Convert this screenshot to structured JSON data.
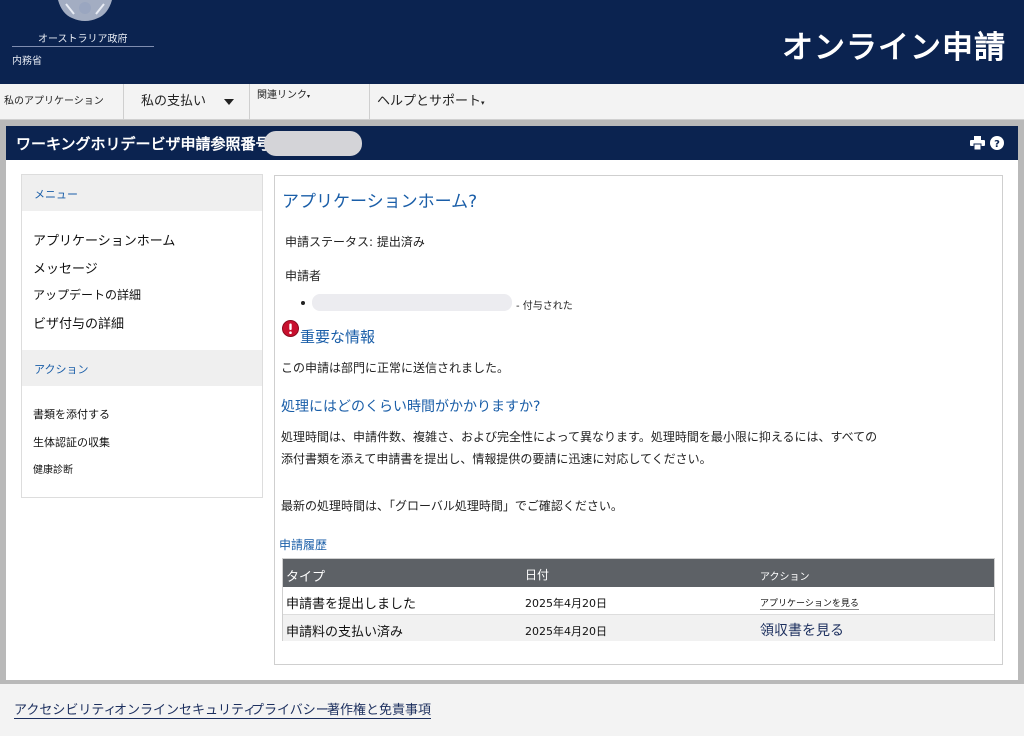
{
  "header": {
    "gov_name": "オーストラリア政府",
    "dept_name": "内務省",
    "title": "オンライン申請"
  },
  "nav": {
    "my_applications": "私のアプリケーション",
    "my_payments": "私の支払い",
    "related_links": "関連リンク",
    "help_support": "ヘルプとサポート"
  },
  "panel": {
    "title": "ワーキングホリデービザ申請参照番号"
  },
  "sidebar": {
    "menu_heading": "メニュー",
    "menu_items": [
      "アプリケーションホーム",
      "メッセージ",
      "アップデートの詳細",
      "ビザ付与の詳細"
    ],
    "action_heading": "アクション",
    "action_items": [
      "書類を添付する",
      "生体認証の収集",
      "健康診断"
    ]
  },
  "main": {
    "title": "アプリケーションホーム?",
    "status": "申請ステータス: 提出済み",
    "applicant_label": "申請者",
    "applicant_status": "- 付与された",
    "important_heading": "重要な情報",
    "sent_message": "この申請は部門に正常に送信されました。",
    "processing_heading": "処理にはどのくらい時間がかかりますか?",
    "processing_line1": "処理時間は、申請件数、複雑さ、および完全性によって異なります。処理時間を最小限に抑えるには、すべての",
    "processing_line2": "添付書類を添えて申請書を提出し、情報提供の要請に迅速に対応してください。",
    "latest_time": "最新の処理時間は、「グローバル処理時間」でご確認ください。",
    "history_heading": "申請履歴"
  },
  "history_table": {
    "headers": [
      "タイプ",
      "日付",
      "アクション"
    ],
    "rows": [
      {
        "type": "申請書を提出しました",
        "date": "2025年4月20日",
        "action": "アプリケーションを見る"
      },
      {
        "type": "申請料の支払い済み",
        "date": "2025年4月20日",
        "action": "領収書を見る"
      }
    ]
  },
  "footer": {
    "links": [
      "アクセシビリティ",
      "オンラインセキュリティ",
      "プライバシー",
      "著作権と免責事項"
    ]
  },
  "colors": {
    "navy": "#0b2350",
    "link_blue": "#1a5ea8",
    "alert_red": "#c8102e",
    "table_header": "#5d6166"
  },
  "icons": [
    "crest-icon",
    "caret-down-icon",
    "print-icon",
    "help-icon",
    "alert-icon"
  ]
}
